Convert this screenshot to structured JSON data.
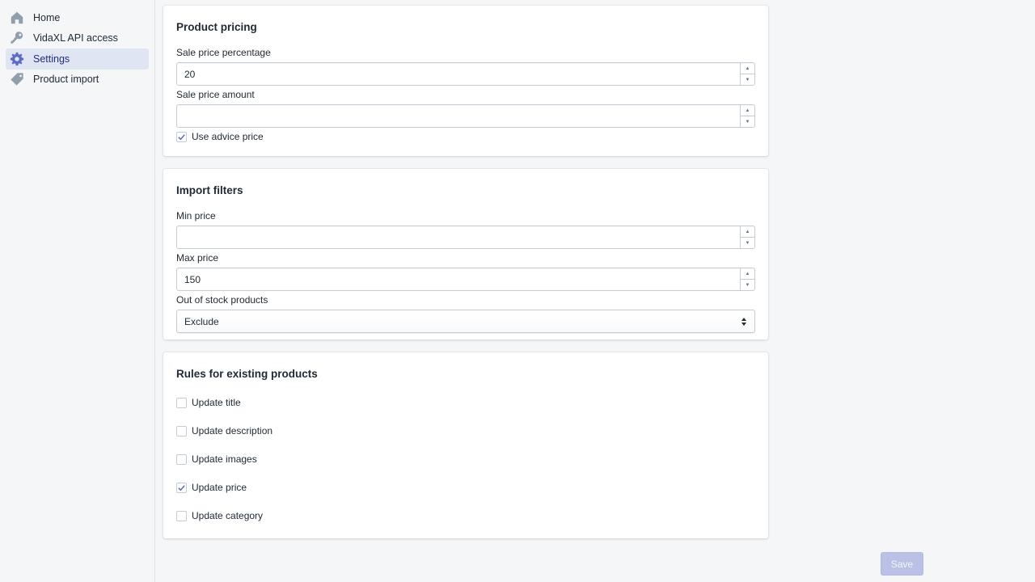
{
  "sidebar": {
    "items": [
      {
        "label": "Home",
        "icon": "home-icon",
        "active": false
      },
      {
        "label": "VidaXL API access",
        "icon": "key-icon",
        "active": false
      },
      {
        "label": "Settings",
        "icon": "gear-icon",
        "active": true
      },
      {
        "label": "Product import",
        "icon": "tag-icon",
        "active": false
      }
    ]
  },
  "product_pricing": {
    "title": "Product pricing",
    "sale_percentage": {
      "label": "Sale price percentage",
      "value": "20"
    },
    "sale_amount": {
      "label": "Sale price amount",
      "value": ""
    },
    "advice_price": {
      "label": "Use advice price",
      "checked": true
    }
  },
  "import_filters": {
    "title": "Import filters",
    "min_price": {
      "label": "Min price",
      "value": ""
    },
    "max_price": {
      "label": "Max price",
      "value": "150"
    },
    "out_of_stock": {
      "label": "Out of stock products",
      "selected": "Exclude"
    }
  },
  "rules": {
    "title": "Rules for existing products",
    "items": [
      {
        "label": "Update title",
        "checked": false
      },
      {
        "label": "Update description",
        "checked": false
      },
      {
        "label": "Update images",
        "checked": false
      },
      {
        "label": "Update price",
        "checked": true
      },
      {
        "label": "Update category",
        "checked": false
      }
    ]
  },
  "actions": {
    "save_label": "Save"
  },
  "colors": {
    "accent": "#5c6ac4",
    "active_nav_bg": "#e0e5f3",
    "save_disabled": "#bac0e6"
  }
}
